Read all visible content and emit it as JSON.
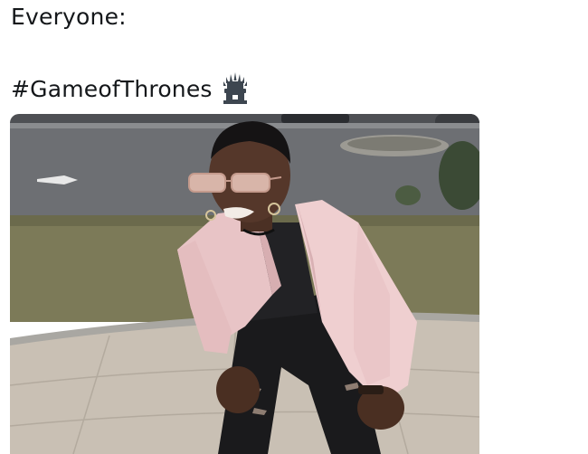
{
  "tweet": {
    "line1": "Everyone:",
    "hashtag": "#GameofThrones",
    "emoji_icon": "iron-throne-icon"
  },
  "photo": {
    "icon": "meme-photo-image"
  }
}
